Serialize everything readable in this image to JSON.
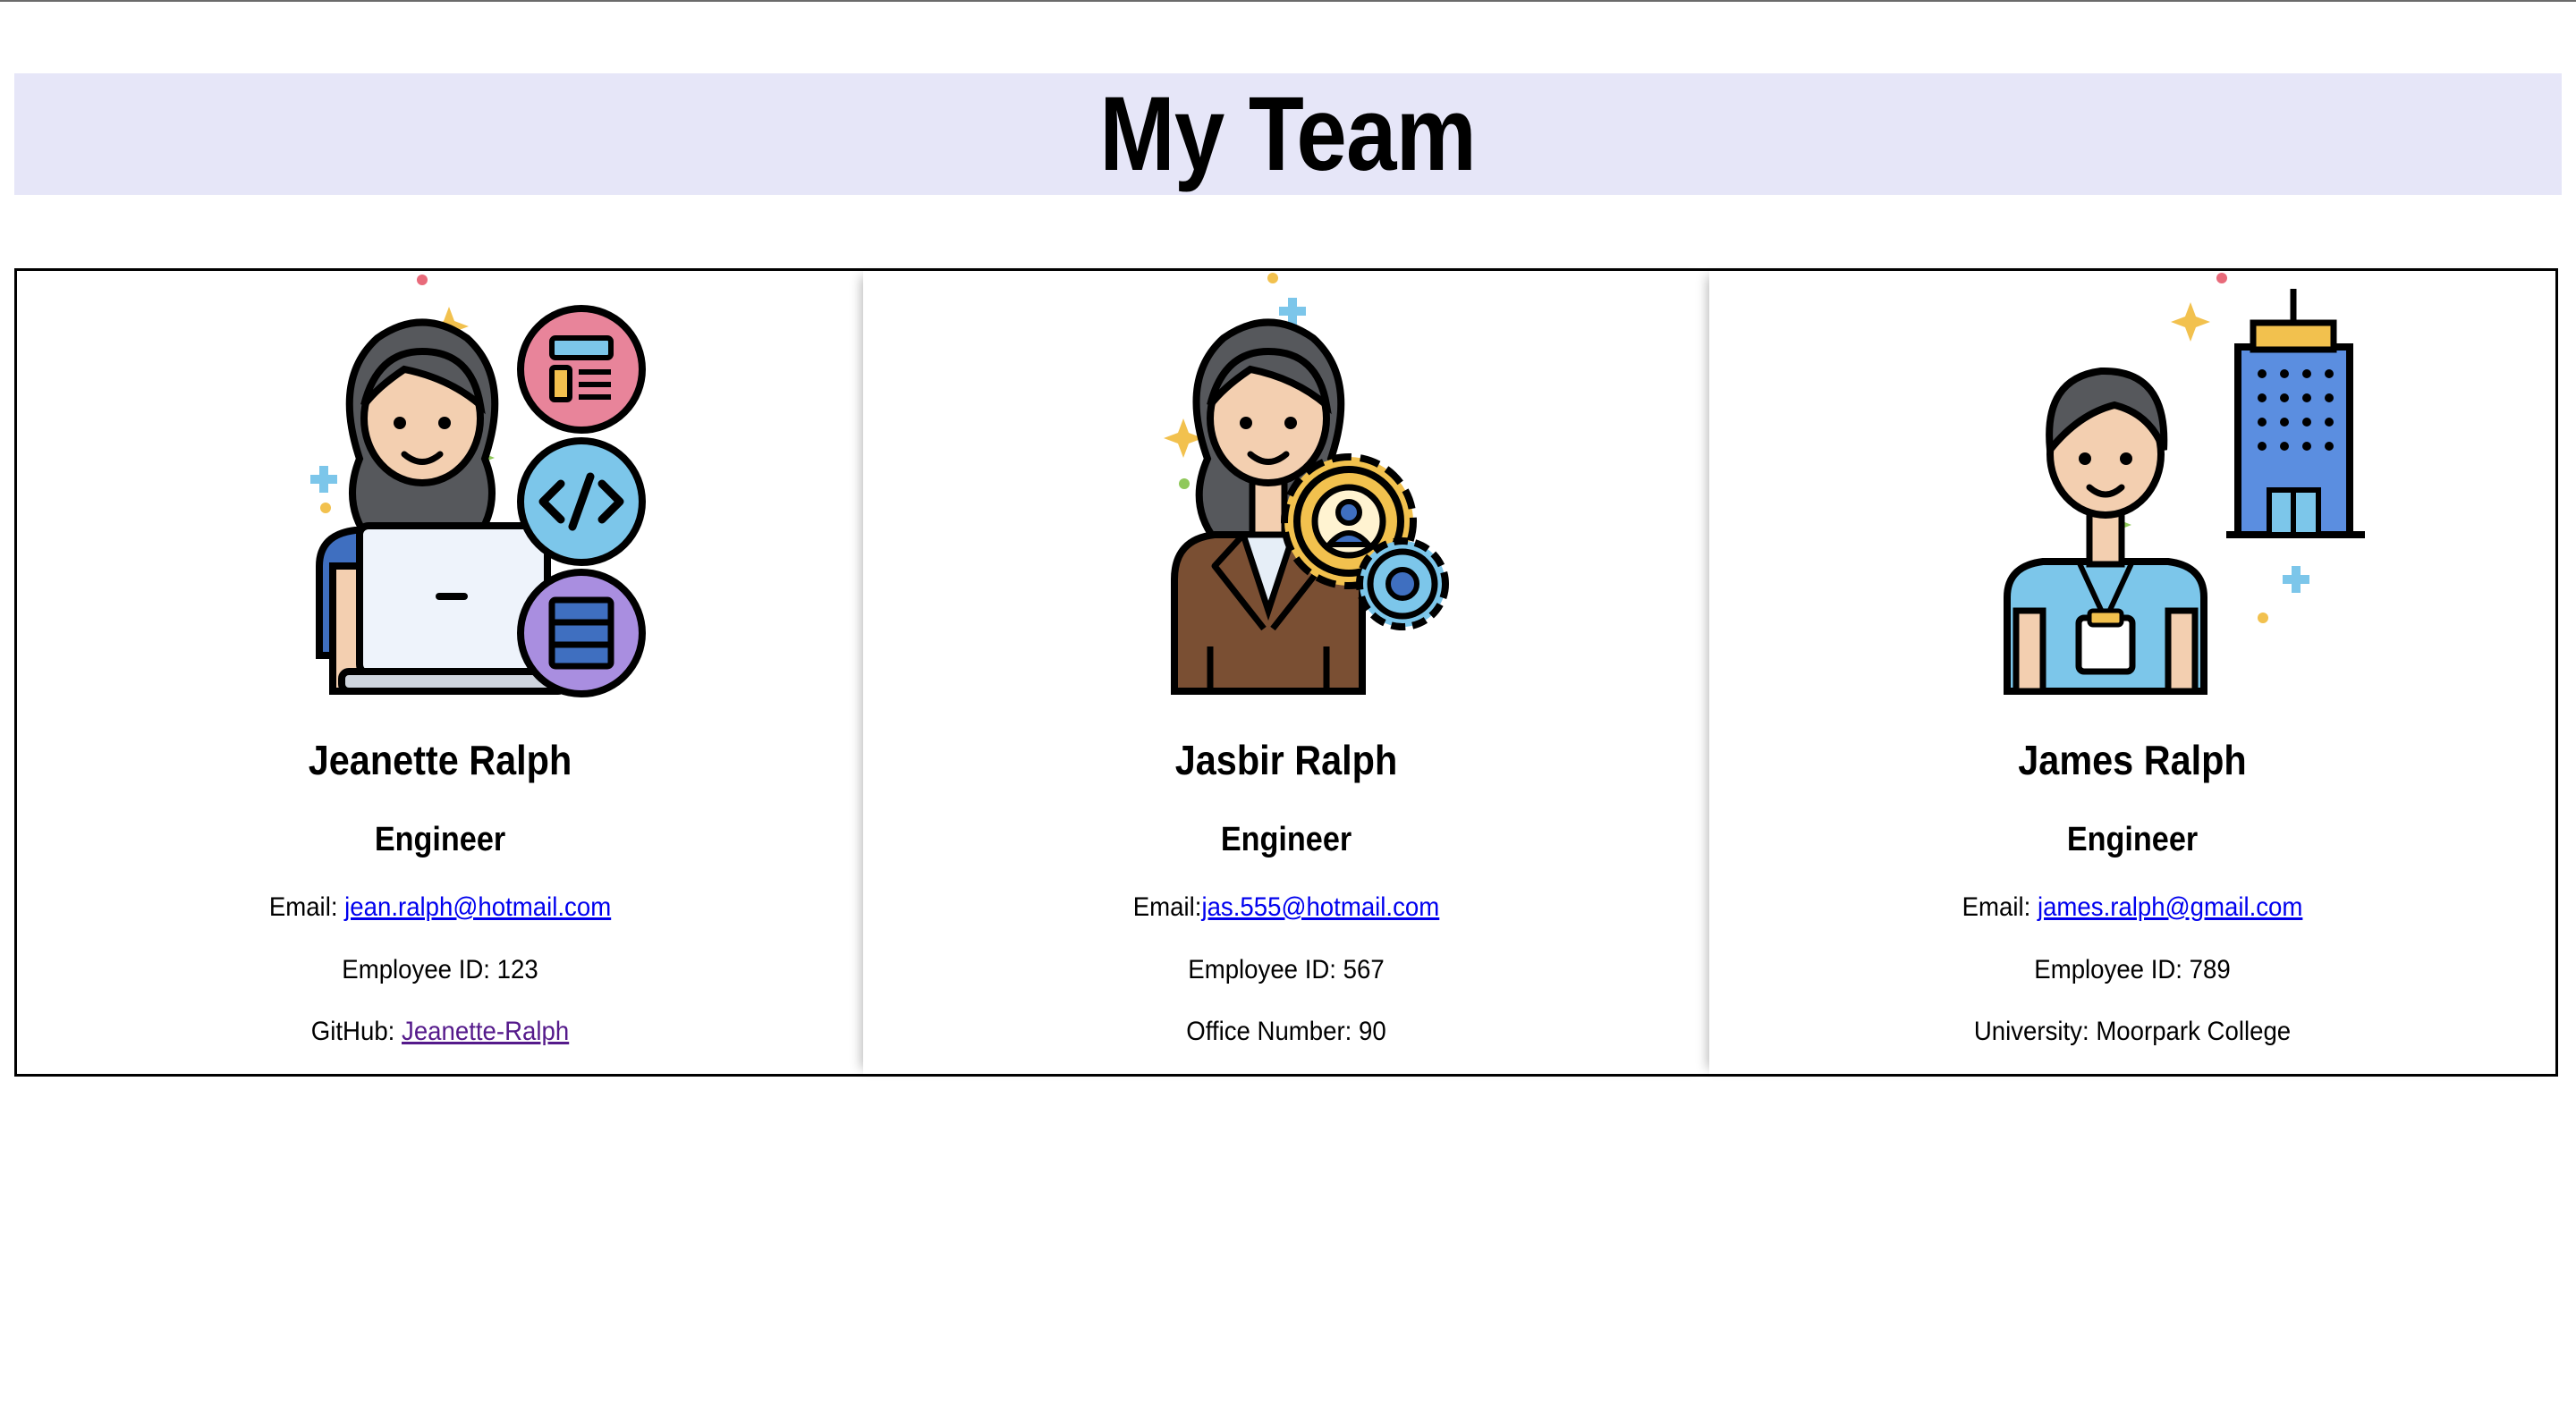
{
  "page": {
    "title": "My Team"
  },
  "team": [
    {
      "name": "Jeanette Ralph",
      "role": "Engineer",
      "email_label": "Email: ",
      "email": "jean.ralph@hotmail.com",
      "id_line": "Employee ID: 123",
      "extra_label": "GitHub: ",
      "extra_link": "Jeanette-Ralph",
      "icon": "developer-avatar-icon"
    },
    {
      "name": "Jasbir Ralph",
      "role": "Engineer",
      "email_label": "Email:",
      "email": "jas.555@hotmail.com",
      "id_line": "Employee ID: 567",
      "extra_text": "Office Number: 90",
      "icon": "manager-avatar-icon"
    },
    {
      "name": "James Ralph",
      "role": "Engineer",
      "email_label": "Email: ",
      "email": "james.ralph@gmail.com",
      "id_line": "Employee ID: 789",
      "extra_text": "University: Moorpark College",
      "icon": "intern-avatar-icon"
    }
  ],
  "colors": {
    "header_bg": "#e6e6f8",
    "link": "#0000ee",
    "visited_link": "#551a8b",
    "border": "#000000"
  }
}
